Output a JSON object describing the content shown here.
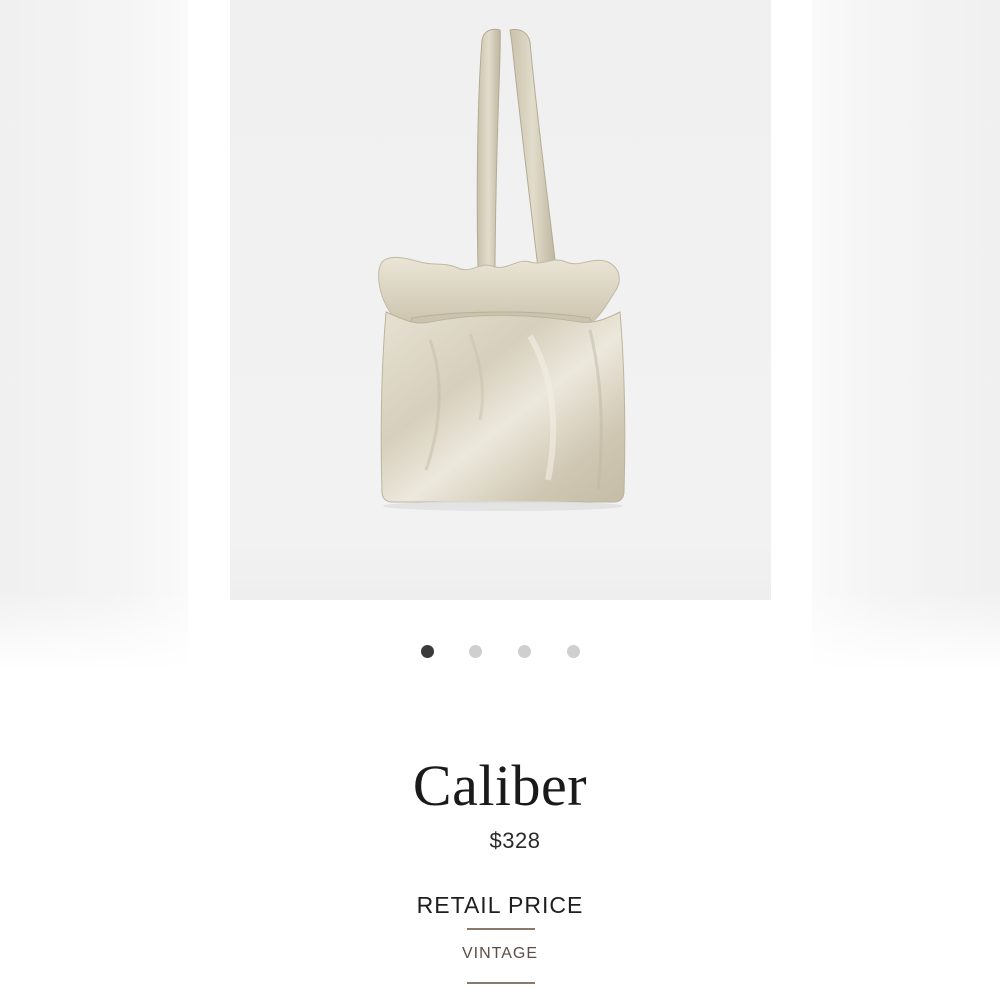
{
  "product": {
    "name": "Caliber",
    "price": "$328",
    "price_type": "RETAIL PRICE",
    "category_link": "VINTAGE",
    "image_icon": "tote-bag-photo"
  },
  "carousel": {
    "total_slides": 4,
    "active_index": 0
  },
  "colors": {
    "background": "#ffffff",
    "hero_background": "#f0f0f0",
    "active_dot": "#3a3a3a",
    "inactive_dot": "#cfcfcf",
    "accent_rule": "#8b7a6b",
    "bag_metallic": "#d9d3c2"
  }
}
